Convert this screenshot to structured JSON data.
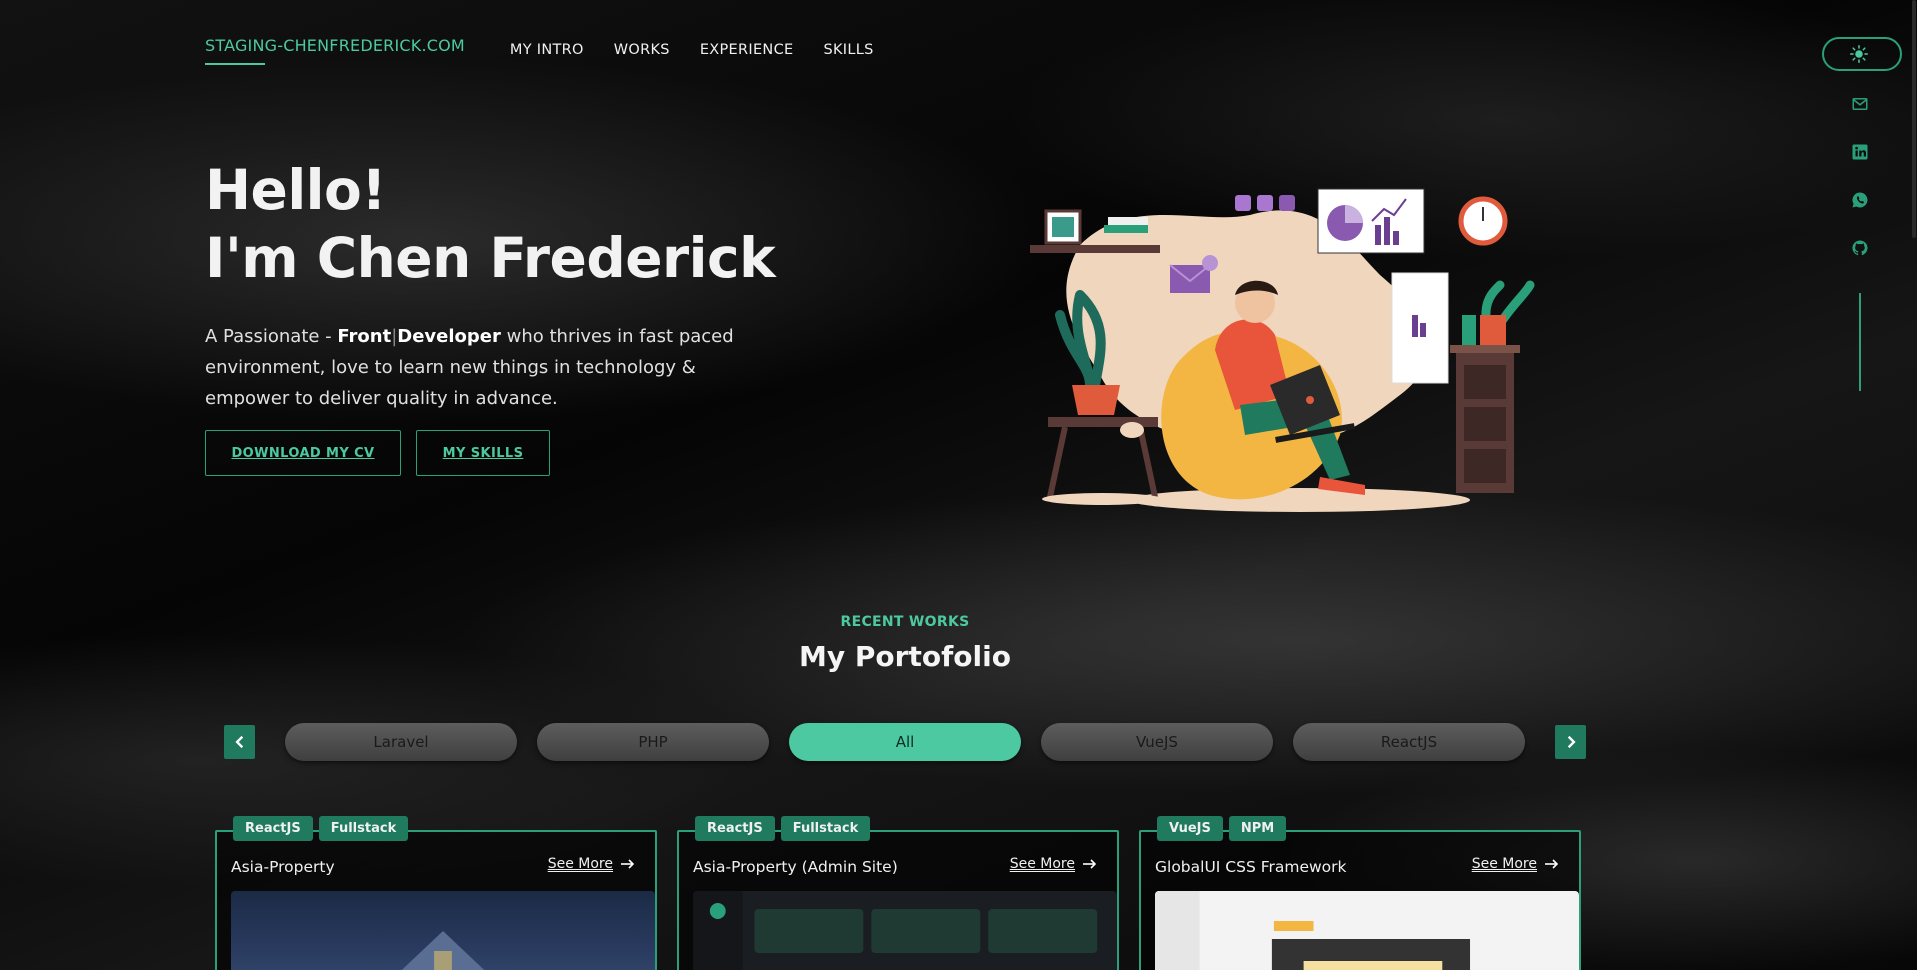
{
  "nav": {
    "brand": "STAGING-CHENFREDERICK.COM",
    "items": [
      "MY INTRO",
      "WORKS",
      "EXPERIENCE",
      "SKILLS"
    ]
  },
  "sidebar": {
    "theme_icon": "sun-icon",
    "socials": [
      "mail-icon",
      "linkedin-icon",
      "whatsapp-icon",
      "github-icon"
    ]
  },
  "hero": {
    "line1": "Hello!",
    "line2": "I'm Chen Frederick",
    "desc_prefix": "A Passionate - ",
    "desc_bold1": "Front",
    "desc_sep": "|",
    "desc_bold2": "Developer",
    "desc_suffix": " who thrives in fast paced environment, love to learn new things in technology & empower to deliver quality in advance.",
    "btn_cv": "DOWNLOAD MY CV",
    "btn_skills": "MY SKILLS"
  },
  "works": {
    "eyebrow": "RECENT WORKS",
    "title": "My Portofolio",
    "filters": [
      "Laravel",
      "PHP",
      "All",
      "VueJS",
      "ReactJS"
    ],
    "active_filter": "All",
    "see_more": "See More",
    "cards": [
      {
        "title": "Asia-Property",
        "tags": [
          "ReactJS",
          "Fullstack"
        ]
      },
      {
        "title": "Asia-Property (Admin Site)",
        "tags": [
          "ReactJS",
          "Fullstack"
        ]
      },
      {
        "title": "GlobalUI CSS Framework",
        "tags": [
          "VueJS",
          "NPM"
        ]
      }
    ]
  },
  "colors": {
    "accent": "#4cc9a0",
    "accent_dark": "#1f7a5e",
    "background": "#0b0b0b"
  }
}
